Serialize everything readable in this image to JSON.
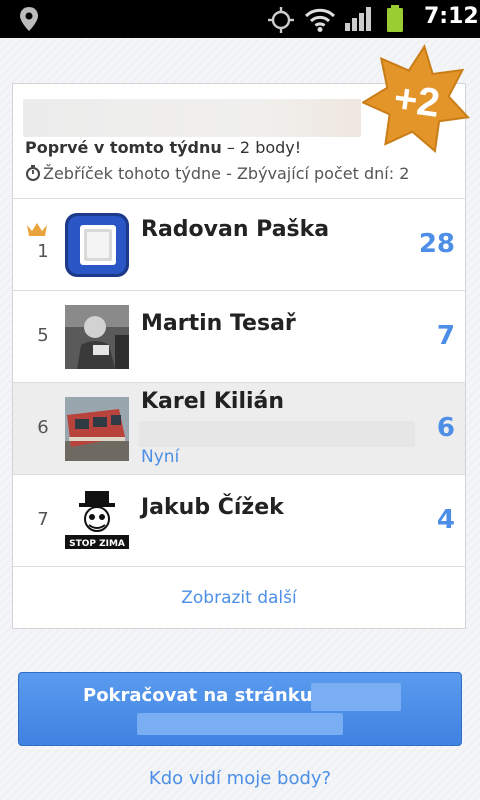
{
  "status_bar": {
    "time": "7:12"
  },
  "header": {
    "first_week_bold": "Poprvé v tomto týdnu",
    "first_week_rest": " – 2 body!",
    "weekly_text": "Žebříček tohoto týdne - Zbývající počet dní: 2",
    "badge_text": "+2"
  },
  "leaderboard": [
    {
      "rank": "1",
      "name": "Radovan Paška",
      "score": "28"
    },
    {
      "rank": "5",
      "name": "Martin Tesař",
      "score": "7"
    },
    {
      "rank": "6",
      "name": "Karel Kilián",
      "score": "6",
      "status": "Nyní"
    },
    {
      "rank": "7",
      "name": "Jakub Čížek",
      "score": "4",
      "avatar_caption": "STOP ZIMA"
    }
  ],
  "show_more": "Zobrazit další",
  "continue_button": "Pokračovat na stránku",
  "who_sees": "Kdo vidí moje body?",
  "colors": {
    "accent": "#4d8fe6",
    "badge": "#e3952a",
    "button": "#4a8ae6"
  }
}
